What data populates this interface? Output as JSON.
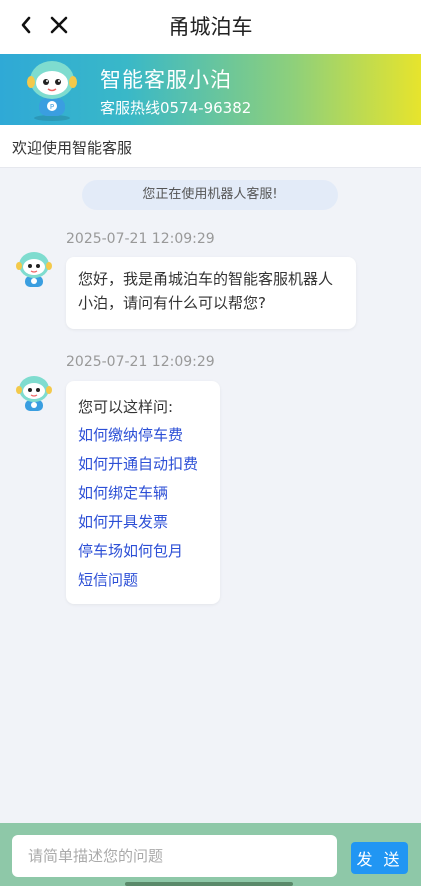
{
  "header": {
    "title": "甬城泊车",
    "back_icon": "chevron-left-icon",
    "close_icon": "close-icon"
  },
  "banner": {
    "name": "智能客服小泊",
    "hotline": "客服热线0574-96382",
    "gradient_colors": [
      "#2fa9d6",
      "#8fd07a",
      "#e7e42c"
    ]
  },
  "welcome": {
    "text": "欢迎使用智能客服"
  },
  "chat": {
    "notice": "您正在使用机器人客服!",
    "messages": [
      {
        "timestamp": "2025-07-21 12:09:29",
        "text": "您好，我是甬城泊车的智能客服机器人小泊，请问有什么可以帮您?"
      },
      {
        "timestamp": "2025-07-21 12:09:29",
        "intro": "您可以这样问:",
        "links": [
          "如何缴纳停车费",
          "如何开通自动扣费",
          "如何绑定车辆",
          "如何开具发票",
          "停车场如何包月",
          "短信问题"
        ]
      }
    ]
  },
  "input": {
    "placeholder": "请简单描述您的问题",
    "value": "",
    "send_label": "发 送"
  },
  "colors": {
    "link": "#2c4fd6",
    "send_button": "#2196f3",
    "input_bar": "#8ec8a8",
    "background": "#f1f3f8"
  }
}
